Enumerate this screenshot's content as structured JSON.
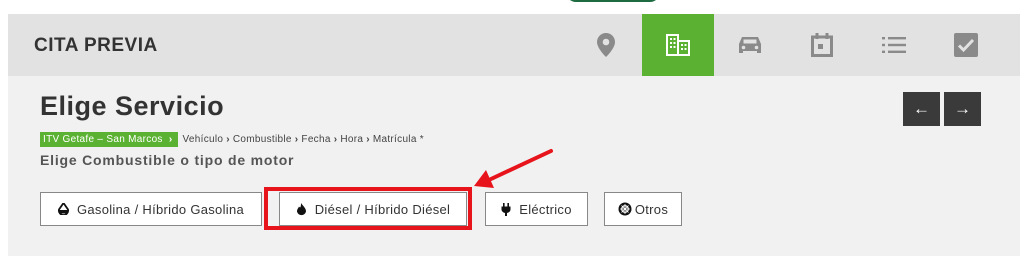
{
  "header": {
    "brand": "CITA PREVIA",
    "nav": [
      {
        "icon": "location-pin-icon",
        "active": false
      },
      {
        "icon": "building-icon",
        "active": true
      },
      {
        "icon": "car-icon",
        "active": false
      },
      {
        "icon": "calendar-icon",
        "active": false
      },
      {
        "icon": "list-icon",
        "active": false
      },
      {
        "icon": "check-icon",
        "active": false
      }
    ]
  },
  "main": {
    "title": "Elige Servicio",
    "breadcrumb": {
      "active": "ITV Getafe – San Marcos",
      "steps": [
        "Vehículo",
        "Combustible",
        "Fecha",
        "Hora",
        "Matrícula *"
      ]
    },
    "subtitle": "Elige Combustible o tipo de motor",
    "prev_label": "←",
    "next_label": "→",
    "options": {
      "gasolina": {
        "label": "Gasolina / Híbrido Gasolina",
        "icon": "drop-icon"
      },
      "diesel": {
        "label": "Diésel / Híbrido Diésel",
        "icon": "flame-icon"
      },
      "electrico": {
        "label": "Eléctrico",
        "icon": "plug-icon"
      },
      "otros": {
        "label": "Otros",
        "icon": "gear-circle-icon"
      }
    }
  },
  "colors": {
    "accent_green": "#5bb232",
    "highlight_red": "#e8141b",
    "header_bg": "#e2e2e2",
    "content_bg": "#f1f1f1"
  }
}
